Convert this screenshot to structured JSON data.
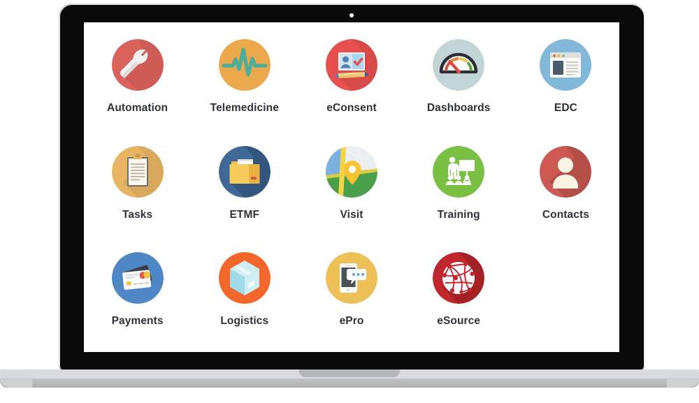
{
  "device": {
    "type": "laptop-mockup",
    "camera": "camera-dot"
  },
  "screen": {
    "background": "#ffffff",
    "label_color": "#2f3337"
  },
  "apps": [
    {
      "id": "automation",
      "label": "Automation",
      "icon": "wrench-icon",
      "circle_color": "#d9625b"
    },
    {
      "id": "telemedicine",
      "label": "Telemedicine",
      "icon": "heartbeat-icon",
      "circle_color": "#eca94c"
    },
    {
      "id": "econsent",
      "label": "eConsent",
      "icon": "id-card-check-icon",
      "circle_color": "#e8504f"
    },
    {
      "id": "dashboards",
      "label": "Dashboards",
      "icon": "gauge-icon",
      "circle_color": "#c3d4d6"
    },
    {
      "id": "edc",
      "label": "EDC",
      "icon": "browser-window-icon",
      "circle_color": "#82b8d9"
    },
    {
      "id": "tasks",
      "label": "Tasks",
      "icon": "clipboard-icon",
      "circle_color": "#e8b564"
    },
    {
      "id": "etmf",
      "label": "ETMF",
      "icon": "folder-icon",
      "circle_color": "#3f6898"
    },
    {
      "id": "visit",
      "label": "Visit",
      "icon": "map-pin-icon",
      "circle_color": "#4aa04a"
    },
    {
      "id": "training",
      "label": "Training",
      "icon": "presenter-icon",
      "circle_color": "#7ac143"
    },
    {
      "id": "contacts",
      "label": "Contacts",
      "icon": "person-icon",
      "circle_color": "#cc5a52"
    },
    {
      "id": "payments",
      "label": "Payments",
      "icon": "credit-card-icon",
      "circle_color": "#4f87c6"
    },
    {
      "id": "logistics",
      "label": "Logistics",
      "icon": "package-box-icon",
      "circle_color": "#f4662a"
    },
    {
      "id": "epro",
      "label": "ePro",
      "icon": "phone-chat-icon",
      "circle_color": "#edc157"
    },
    {
      "id": "esource",
      "label": "eSource",
      "icon": "network-globe-icon",
      "circle_color": "#c0262b"
    }
  ]
}
